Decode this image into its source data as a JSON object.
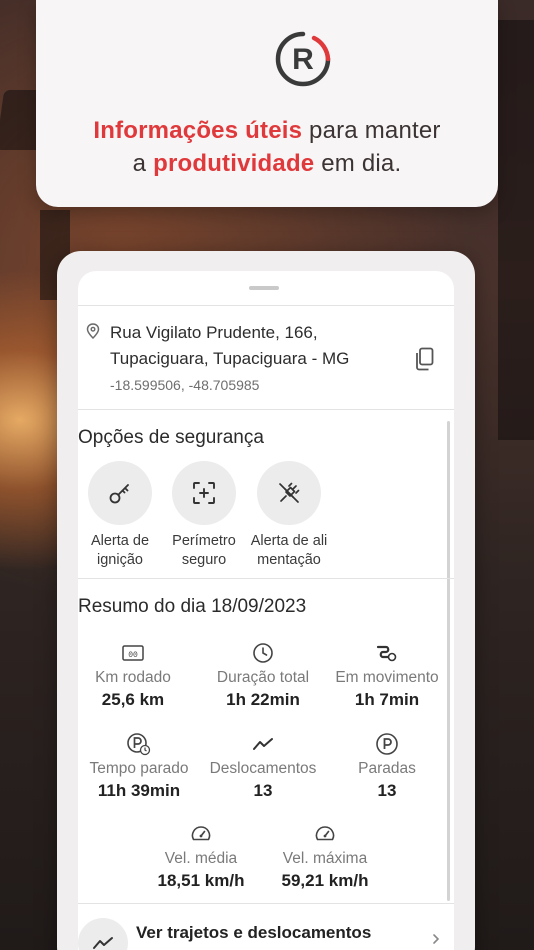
{
  "header": {
    "brand_letter": "R",
    "tagline": {
      "part1": "Informações úteis",
      "part2": " para manter",
      "part3": "a ",
      "part4": "produtividade",
      "part5": " em dia."
    }
  },
  "colors": {
    "accent": "#e0393c",
    "logo_dark": "#3a3a3a"
  },
  "location": {
    "icon": "map-pin-icon",
    "line1": "Rua Vigilato Prudente, 166,",
    "line2": "Tupaciguara, Tupaciguara - MG",
    "coords": "-18.599506, -48.705985",
    "copy_icon": "copy-icon"
  },
  "security": {
    "title": "Opções de segurança",
    "options": [
      {
        "icon": "key-icon",
        "line1": "Alerta de",
        "line2": "ignição"
      },
      {
        "icon": "perimeter-icon",
        "line1": "Perímetro",
        "line2": "seguro"
      },
      {
        "icon": "power-plug-off-icon",
        "line1": "Alerta de ali",
        "line2": "mentação"
      }
    ]
  },
  "summary": {
    "title": "Resumo do dia 18/09/2023",
    "stats": [
      {
        "icon": "odometer-icon",
        "label": "Km rodado",
        "value": "25,6 km"
      },
      {
        "icon": "clock-icon",
        "label": "Duração total",
        "value": "1h 22min"
      },
      {
        "icon": "route-moving-icon",
        "label": "Em movimento",
        "value": "1h 7min"
      },
      {
        "icon": "parking-timer-icon",
        "label": "Tempo parado",
        "value": "11h 39min"
      },
      {
        "icon": "trend-line-icon",
        "label": "Deslocamentos",
        "value": "13"
      },
      {
        "icon": "parking-icon",
        "label": "Paradas",
        "value": "13"
      },
      {
        "icon": "speedometer-icon",
        "label": "Vel. média",
        "value": "18,51 km/h"
      },
      {
        "icon": "speedometer-icon",
        "label": "Vel. máxima",
        "value": "59,21 km/h"
      }
    ]
  },
  "trips": {
    "icon": "trend-line-icon",
    "label": "Ver trajetos e deslocamentos"
  }
}
